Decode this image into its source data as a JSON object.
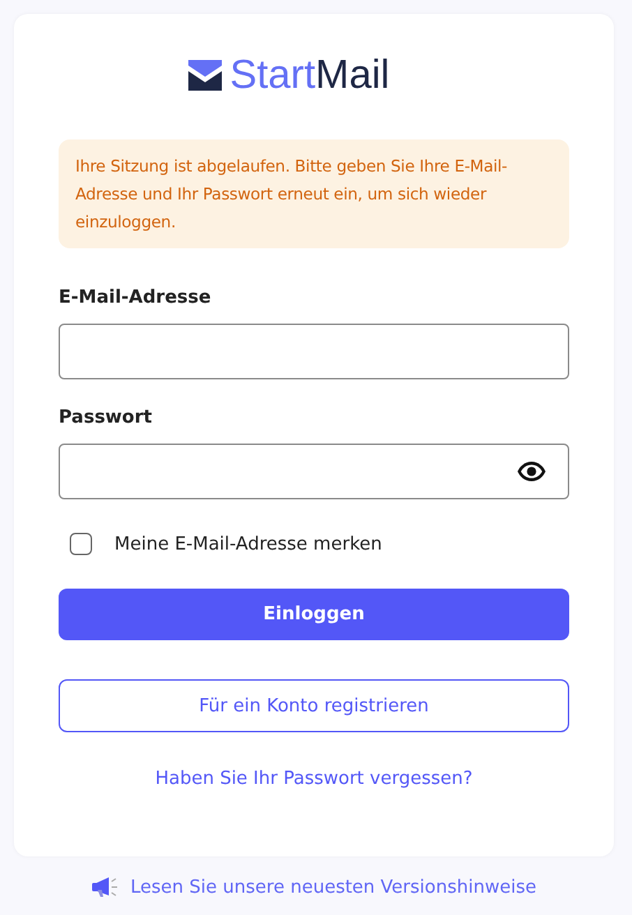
{
  "logo": {
    "first": "Start",
    "second": "Mail"
  },
  "alert": {
    "text": "Ihre Sitzung ist abgelaufen. Bitte geben Sie Ihre E-Mail-Adresse und Ihr Passwort erneut ein, um sich wieder einzuloggen."
  },
  "fields": [
    {
      "label": "E-Mail-Adresse",
      "kind": "text"
    },
    {
      "label": "Passwort",
      "kind": "password"
    }
  ],
  "remember": {
    "label": "Meine E-Mail-Adresse merken",
    "checked": false
  },
  "login_button": "Einloggen",
  "register_button": "Für ein Konto registrieren",
  "forgot_link": "Haben Sie Ihr Passwort vergessen?",
  "footer_link": "Lesen Sie unsere neuesten Versionshinweise"
}
